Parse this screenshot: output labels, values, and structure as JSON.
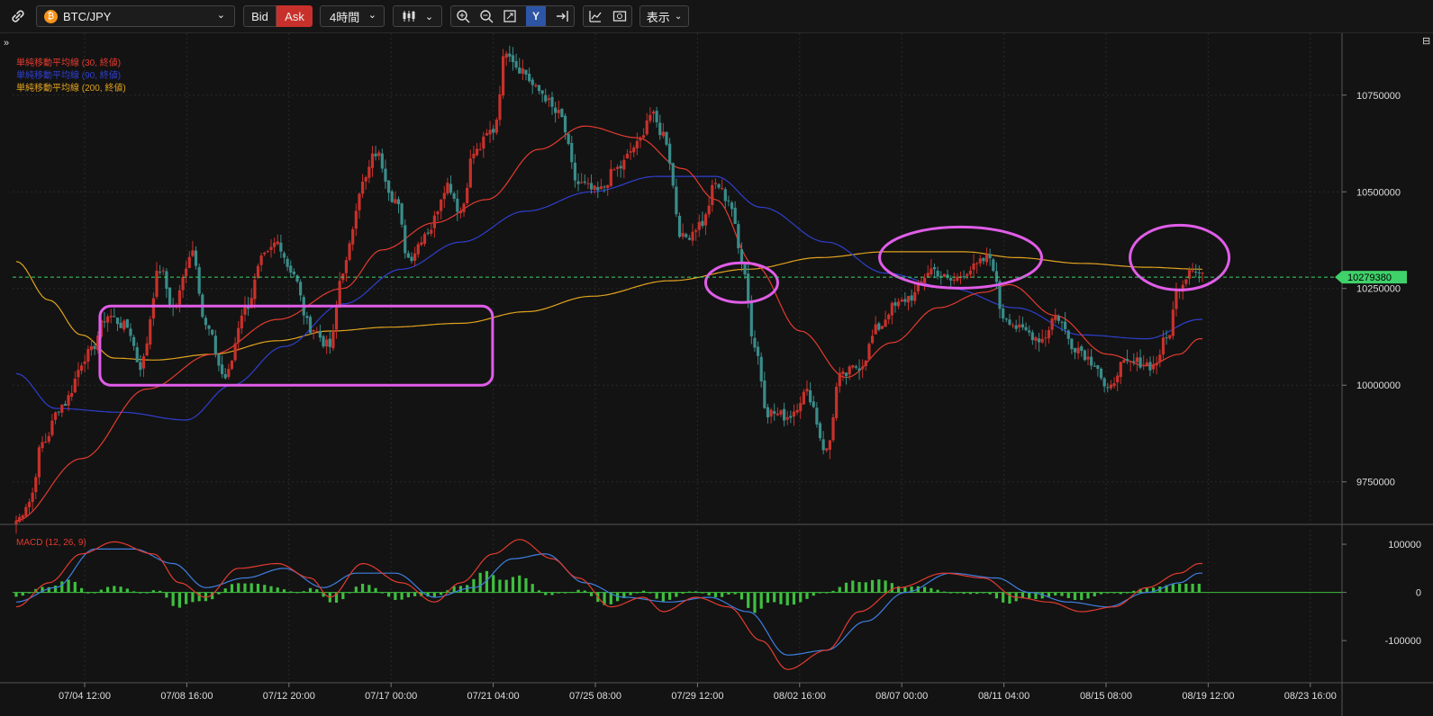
{
  "toolbar": {
    "symbol": "BTC/JPY",
    "bid_label": "Bid",
    "ask_label": "Ask",
    "interval": "4時間",
    "display_label": "表示",
    "ask_color": "#c8312b",
    "active_tool_color": "#2d55a6"
  },
  "chart_data": [
    {
      "type": "candlestick",
      "current_price": 10279380,
      "current_price_label": "10279380",
      "y_ticks": [
        9750000,
        10000000,
        10250000,
        10500000,
        10750000
      ],
      "y_tick_labels": [
        "9750000",
        "10000000",
        "10250000",
        "10500000",
        "10750000"
      ],
      "ylim": [
        9640000,
        10910000
      ],
      "x_ticks": [
        "07/04 12:00",
        "07/08 16:00",
        "07/12 20:00",
        "07/17 00:00",
        "07/21 04:00",
        "07/25 08:00",
        "07/29 12:00",
        "08/02 16:00",
        "08/07 00:00",
        "08/11 04:00",
        "08/15 08:00",
        "08/19 12:00",
        "08/23 16:00"
      ],
      "legend": [
        {
          "label": "単純移動平均線 (30, 終値)",
          "color": "#e33b2f"
        },
        {
          "label": "単純移動平均線 (90, 終値)",
          "color": "#2f3fcf"
        },
        {
          "label": "単純移動平均線 (200, 終値)",
          "color": "#e0a21f"
        }
      ],
      "price_anchors": [
        [
          0,
          9650000
        ],
        [
          4,
          9700000
        ],
        [
          8,
          9850000
        ],
        [
          14,
          9950000
        ],
        [
          22,
          10080000
        ],
        [
          28,
          10180000
        ],
        [
          34,
          10150000
        ],
        [
          38,
          10050000
        ],
        [
          44,
          10300000
        ],
        [
          48,
          10200000
        ],
        [
          54,
          10350000
        ],
        [
          58,
          10150000
        ],
        [
          64,
          10020000
        ],
        [
          70,
          10200000
        ],
        [
          76,
          10330000
        ],
        [
          80,
          10370000
        ],
        [
          84,
          10300000
        ],
        [
          90,
          10150000
        ],
        [
          96,
          10100000
        ],
        [
          100,
          10300000
        ],
        [
          106,
          10520000
        ],
        [
          110,
          10600000
        ],
        [
          116,
          10480000
        ],
        [
          120,
          10330000
        ],
        [
          126,
          10400000
        ],
        [
          132,
          10520000
        ],
        [
          136,
          10450000
        ],
        [
          140,
          10600000
        ],
        [
          146,
          10660000
        ],
        [
          150,
          10870000
        ],
        [
          154,
          10820000
        ],
        [
          160,
          10760000
        ],
        [
          166,
          10700000
        ],
        [
          172,
          10520000
        ],
        [
          178,
          10500000
        ],
        [
          184,
          10560000
        ],
        [
          190,
          10620000
        ],
        [
          194,
          10700000
        ],
        [
          198,
          10650000
        ],
        [
          204,
          10380000
        ],
        [
          210,
          10420000
        ],
        [
          214,
          10520000
        ],
        [
          218,
          10480000
        ],
        [
          222,
          10330000
        ],
        [
          226,
          10100000
        ],
        [
          230,
          9930000
        ],
        [
          236,
          9920000
        ],
        [
          242,
          9980000
        ],
        [
          248,
          9830000
        ],
        [
          252,
          10020000
        ],
        [
          258,
          10050000
        ],
        [
          264,
          10150000
        ],
        [
          268,
          10200000
        ],
        [
          274,
          10230000
        ],
        [
          280,
          10300000
        ],
        [
          286,
          10270000
        ],
        [
          292,
          10300000
        ],
        [
          298,
          10330000
        ],
        [
          302,
          10180000
        ],
        [
          308,
          10140000
        ],
        [
          314,
          10120000
        ],
        [
          318,
          10180000
        ],
        [
          324,
          10100000
        ],
        [
          330,
          10060000
        ],
        [
          334,
          9980000
        ],
        [
          338,
          10050000
        ],
        [
          344,
          10060000
        ],
        [
          348,
          10050000
        ],
        [
          352,
          10120000
        ],
        [
          356,
          10260000
        ],
        [
          360,
          10310000
        ],
        [
          362,
          10290000
        ]
      ],
      "sma30_anchors": [
        [
          0,
          9650000
        ],
        [
          20,
          9810000
        ],
        [
          40,
          9990000
        ],
        [
          60,
          10080000
        ],
        [
          80,
          10170000
        ],
        [
          100,
          10250000
        ],
        [
          112,
          10350000
        ],
        [
          128,
          10420000
        ],
        [
          144,
          10480000
        ],
        [
          160,
          10610000
        ],
        [
          174,
          10670000
        ],
        [
          190,
          10640000
        ],
        [
          204,
          10560000
        ],
        [
          214,
          10480000
        ],
        [
          226,
          10310000
        ],
        [
          240,
          10140000
        ],
        [
          254,
          10020000
        ],
        [
          268,
          10110000
        ],
        [
          282,
          10200000
        ],
        [
          296,
          10240000
        ],
        [
          304,
          10260000
        ],
        [
          318,
          10180000
        ],
        [
          334,
          10080000
        ],
        [
          346,
          10050000
        ],
        [
          356,
          10080000
        ],
        [
          362,
          10120000
        ]
      ],
      "sma90_anchors": [
        [
          0,
          10030000
        ],
        [
          12,
          9940000
        ],
        [
          32,
          9930000
        ],
        [
          52,
          9910000
        ],
        [
          66,
          10000000
        ],
        [
          82,
          10100000
        ],
        [
          100,
          10210000
        ],
        [
          118,
          10300000
        ],
        [
          136,
          10370000
        ],
        [
          156,
          10450000
        ],
        [
          176,
          10500000
        ],
        [
          196,
          10540000
        ],
        [
          214,
          10540000
        ],
        [
          228,
          10460000
        ],
        [
          248,
          10370000
        ],
        [
          266,
          10290000
        ],
        [
          286,
          10250000
        ],
        [
          306,
          10200000
        ],
        [
          326,
          10130000
        ],
        [
          346,
          10120000
        ],
        [
          362,
          10170000
        ]
      ],
      "sma200_anchors": [
        [
          0,
          10320000
        ],
        [
          10,
          10220000
        ],
        [
          20,
          10130000
        ],
        [
          30,
          10070000
        ],
        [
          42,
          10065000
        ],
        [
          60,
          10080000
        ],
        [
          80,
          10115000
        ],
        [
          96,
          10140000
        ],
        [
          114,
          10150000
        ],
        [
          136,
          10160000
        ],
        [
          156,
          10190000
        ],
        [
          176,
          10230000
        ],
        [
          200,
          10270000
        ],
        [
          224,
          10300000
        ],
        [
          246,
          10330000
        ],
        [
          266,
          10345000
        ],
        [
          290,
          10345000
        ],
        [
          306,
          10330000
        ],
        [
          326,
          10315000
        ],
        [
          346,
          10305000
        ],
        [
          362,
          10300000
        ]
      ]
    },
    {
      "type": "macd",
      "label": "MACD (12, 26, 9)",
      "y_ticks": [
        100000,
        0,
        -100000
      ],
      "y_tick_labels": [
        "100000",
        "0",
        "-100000"
      ],
      "ylim": [
        -180000,
        130000
      ],
      "macd_anchors": [
        [
          0,
          -30000
        ],
        [
          10,
          20000
        ],
        [
          20,
          80000
        ],
        [
          30,
          105000
        ],
        [
          42,
          80000
        ],
        [
          50,
          20000
        ],
        [
          58,
          -10000
        ],
        [
          68,
          50000
        ],
        [
          80,
          60000
        ],
        [
          90,
          30000
        ],
        [
          96,
          -10000
        ],
        [
          106,
          60000
        ],
        [
          118,
          20000
        ],
        [
          128,
          -20000
        ],
        [
          136,
          20000
        ],
        [
          146,
          80000
        ],
        [
          154,
          110000
        ],
        [
          164,
          70000
        ],
        [
          172,
          30000
        ],
        [
          182,
          -30000
        ],
        [
          192,
          -10000
        ],
        [
          198,
          -40000
        ],
        [
          208,
          -10000
        ],
        [
          218,
          -30000
        ],
        [
          228,
          -100000
        ],
        [
          236,
          -160000
        ],
        [
          248,
          -120000
        ],
        [
          258,
          -40000
        ],
        [
          270,
          10000
        ],
        [
          284,
          40000
        ],
        [
          296,
          30000
        ],
        [
          306,
          -10000
        ],
        [
          316,
          -20000
        ],
        [
          326,
          -40000
        ],
        [
          336,
          -30000
        ],
        [
          346,
          10000
        ],
        [
          356,
          40000
        ],
        [
          362,
          60000
        ]
      ],
      "signal_anchors": [
        [
          0,
          -20000
        ],
        [
          12,
          10000
        ],
        [
          24,
          90000
        ],
        [
          36,
          90000
        ],
        [
          48,
          60000
        ],
        [
          58,
          10000
        ],
        [
          70,
          30000
        ],
        [
          82,
          50000
        ],
        [
          94,
          10000
        ],
        [
          104,
          40000
        ],
        [
          116,
          40000
        ],
        [
          128,
          -10000
        ],
        [
          140,
          10000
        ],
        [
          152,
          70000
        ],
        [
          162,
          80000
        ],
        [
          174,
          20000
        ],
        [
          186,
          -10000
        ],
        [
          200,
          -20000
        ],
        [
          212,
          -10000
        ],
        [
          224,
          -40000
        ],
        [
          236,
          -130000
        ],
        [
          248,
          -120000
        ],
        [
          260,
          -60000
        ],
        [
          272,
          0
        ],
        [
          286,
          40000
        ],
        [
          300,
          30000
        ],
        [
          310,
          0
        ],
        [
          322,
          -20000
        ],
        [
          334,
          -30000
        ],
        [
          346,
          0
        ],
        [
          356,
          20000
        ],
        [
          362,
          40000
        ]
      ],
      "hist_color": "#3fbf3f"
    }
  ],
  "colors": {
    "candle_up": "#c8312b",
    "candle_down": "#3a8c8a",
    "current_price": "#3fd16a",
    "annotation": "#e05de8"
  }
}
